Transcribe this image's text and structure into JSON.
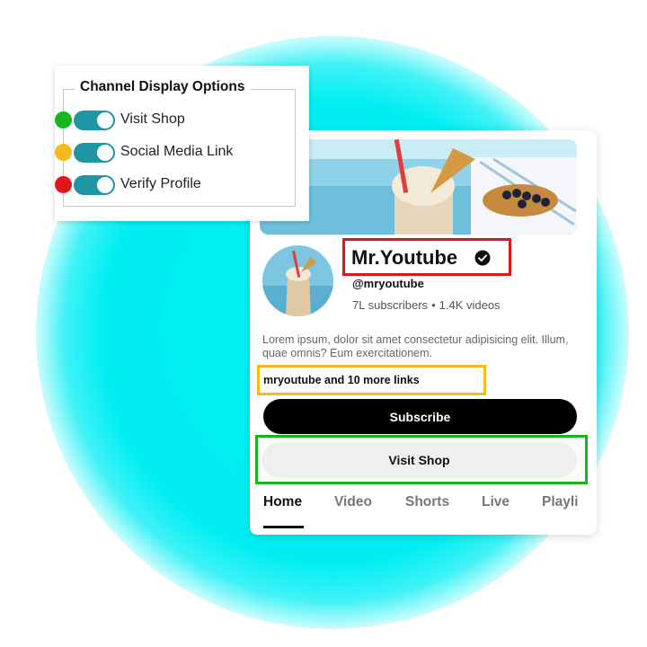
{
  "options_panel": {
    "title": "Channel Display Options",
    "items": [
      {
        "label": "Visit Shop",
        "enabled": true,
        "marker_color": "#16b61e"
      },
      {
        "label": "Social Media Link",
        "enabled": true,
        "marker_color": "#f5bb1d"
      },
      {
        "label": "Verify Profile",
        "enabled": true,
        "marker_color": "#e2151c"
      }
    ],
    "toggle_color": "#1f96a4"
  },
  "channel": {
    "name": "Mr.Youtube",
    "verified_icon": "verified-check-icon",
    "handle": "@mryoutube",
    "subscribers": "7L subscribers",
    "videos": "1.4K videos",
    "description": "Lorem ipsum, dolor sit amet consectetur adipisicing elit. Illum, quae omnis? Eum exercitationem.",
    "links": "mryoutube and 10 more links",
    "subscribe_label": "Subscribe",
    "shop_label": "Visit Shop",
    "tabs": [
      {
        "label": "Home",
        "active": true
      },
      {
        "label": "Video",
        "active": false
      },
      {
        "label": "Shorts",
        "active": false
      },
      {
        "label": "Live",
        "active": false
      },
      {
        "label": "Playli",
        "active": false
      }
    ]
  },
  "colors": {
    "glow": "#00eef3",
    "name_highlight": "#e2151c",
    "links_highlight": "#f5bb1d",
    "shop_highlight": "#16b61e"
  }
}
